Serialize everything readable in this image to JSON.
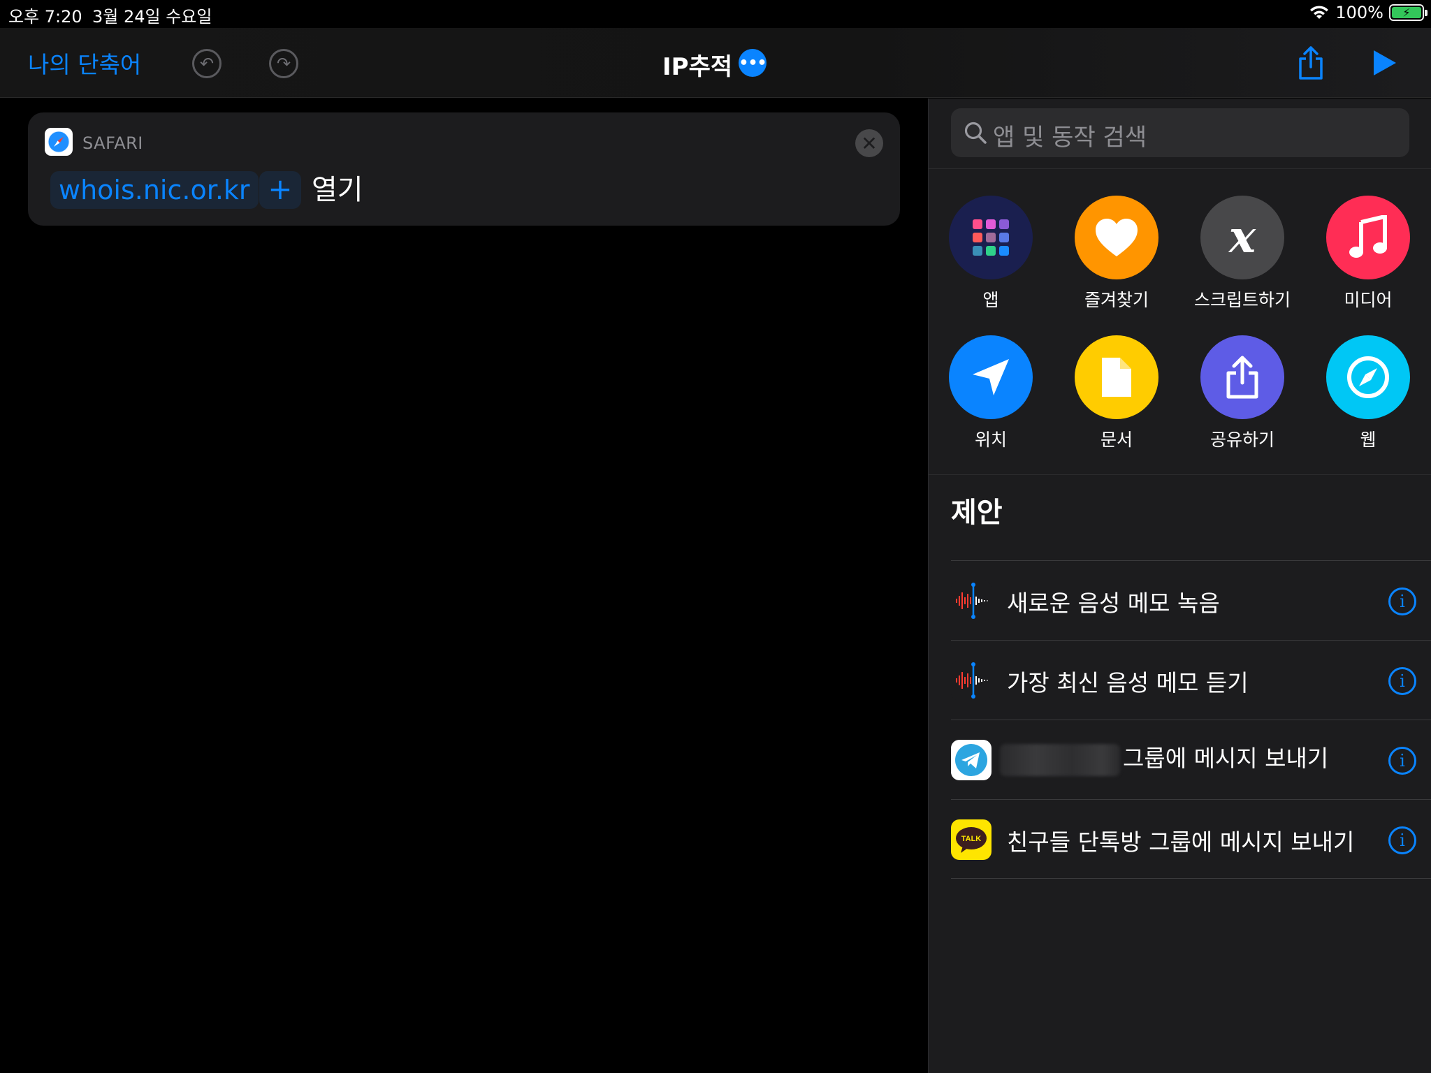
{
  "status_bar": {
    "time": "오후 7:20",
    "date": "3월 24일 수요일",
    "battery": "100%"
  },
  "header": {
    "back_label": "나의 단축어",
    "title": "IP추적"
  },
  "action": {
    "app_label": "SAFARI",
    "url_token": "whois.nic.or.kr",
    "plus": "+",
    "verb": "열기"
  },
  "panel": {
    "search_placeholder": "앱 및 동작 검색",
    "categories": [
      {
        "label": "앱",
        "icon": "app-grid-icon",
        "color": "#1a1f4f"
      },
      {
        "label": "즐겨찾기",
        "icon": "heart-icon",
        "color": "#ff9500"
      },
      {
        "label": "스크립트하기",
        "icon": "script-icon",
        "color": "#48484a"
      },
      {
        "label": "미디어",
        "icon": "music-note-icon",
        "color": "#ff2d55"
      },
      {
        "label": "위치",
        "icon": "location-arrow-icon",
        "color": "#0a84ff"
      },
      {
        "label": "문서",
        "icon": "document-icon",
        "color": "#ffcc00"
      },
      {
        "label": "공유하기",
        "icon": "share-icon",
        "color": "#5e5ce6"
      },
      {
        "label": "웹",
        "icon": "compass-icon",
        "color": "#00c7f5"
      }
    ],
    "suggestions_title": "제안",
    "suggestions": [
      {
        "text": "새로운 음성 메모 녹음",
        "icon": "voice-memo-icon"
      },
      {
        "text": "가장 최신 음성 메모 듣기",
        "icon": "voice-memo-icon"
      },
      {
        "text": "그룹에 메시지 보내기",
        "icon": "telegram-icon"
      },
      {
        "text": "친구들 단톡방 그룹에 메시지 보내기",
        "icon": "kakaotalk-icon",
        "badge": "TALK"
      }
    ]
  }
}
